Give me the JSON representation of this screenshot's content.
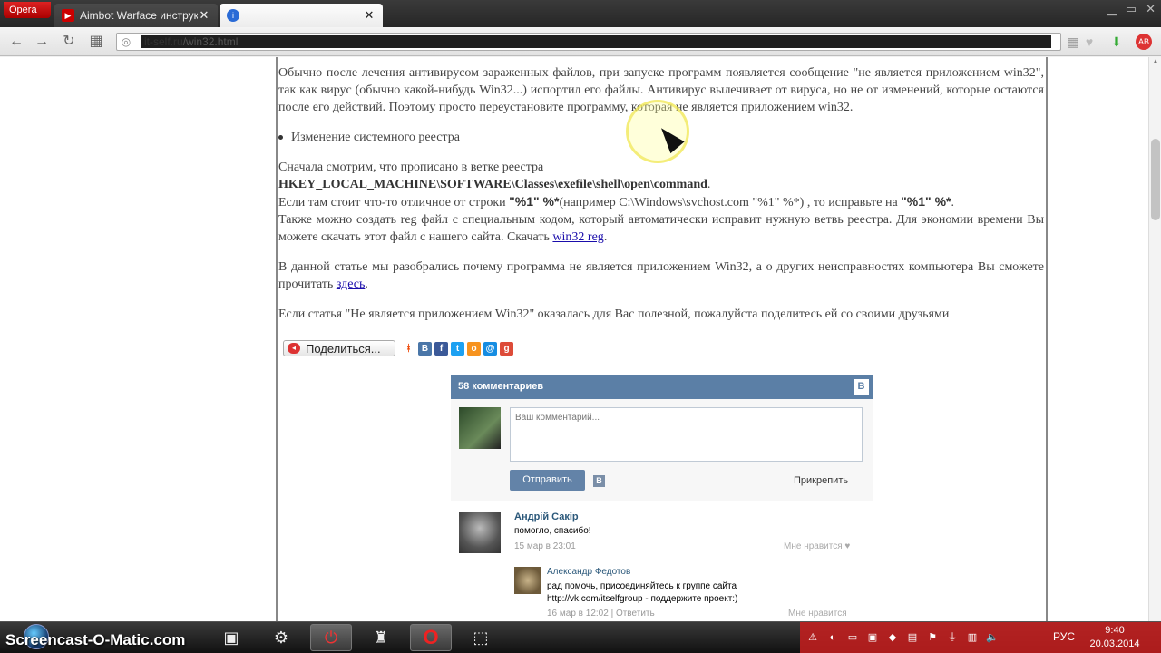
{
  "browser": {
    "opera_label": "Opera",
    "tabs": [
      {
        "title": "Aimbot Warface инструкция",
        "icon": "youtube-icon"
      },
      {
        "title": "",
        "icon": "info-icon"
      }
    ],
    "address": {
      "domain": "it-self.ru",
      "path": "/win32.html"
    }
  },
  "article": {
    "p1": "Обычно после лечения антивирусом зараженных файлов, при запуске программ появляется сообщение \"не является приложением win32\", так как вирус (обычно какой-нибудь Win32...) испортил его файлы. Антивирус вылечивает от вируса, но не от изменений, которые остаются после его действий. Поэтому просто переустановите программу, которая не является приложением win32.",
    "bullet": "Изменение системного реестра",
    "p2_line1": "Сначала смотрим, что прописано в ветке реестра",
    "p2_registry": "HKEY_LOCAL_MACHINE\\SOFTWARE\\Classes\\exefile\\shell\\open\\command",
    "p2_period": ".",
    "p2_line3a": "Если там стоит что-то отличное от строки ",
    "p2_code1": "\"%1\" %*",
    "p2_line3b": "(например C:\\Windows\\svchost.com \"%1\" %*) , то исправьте на ",
    "p2_code2": "\"%1\" %*",
    "p2_line3c": ".",
    "p2_line4": "Также можно создать reg файл с специальным кодом, который автоматически исправит нужную ветвь реестра. Для экономии времени Вы можете скачать этот файл с нашего сайта. Скачать ",
    "p2_link": "win32 reg",
    "p2_end": ".",
    "p3": "В данной статье мы разобрались почему программа не является приложением Win32, а о других неисправностях компьютера Вы сможете прочитать ",
    "p3_link": "здесь",
    "p3_end": ".",
    "p4": "Если статья \"Не является приложением Win32\" оказалась для Вас полезной, пожалуйста поделитесь ей со своими друзьями"
  },
  "share": {
    "button_label": "Поделиться..."
  },
  "vk": {
    "header": "58 комментариев",
    "logo": "В",
    "placeholder": "Ваш комментарий...",
    "send_label": "Отправить",
    "attach_label": "Прикрепить",
    "comments": [
      {
        "name": "Андрій Сакір",
        "text": "помогло, спасибо!",
        "date": "15 мар в 23:01",
        "like": "Мне нравится"
      }
    ],
    "reply": {
      "name": "Александр Федотов",
      "text1": "рад помочь, присоединяйтесь к группе сайта",
      "text2": "http://vk.com/itselfgroup - поддержите проект:)",
      "date": "16 мар в 12:02 | Ответить",
      "like": "Мне нравится"
    }
  },
  "taskbar": {
    "logo": "Screencast-O-Matic.com",
    "lang": "РУС",
    "time": "9:40",
    "date": "20.03.2014"
  }
}
